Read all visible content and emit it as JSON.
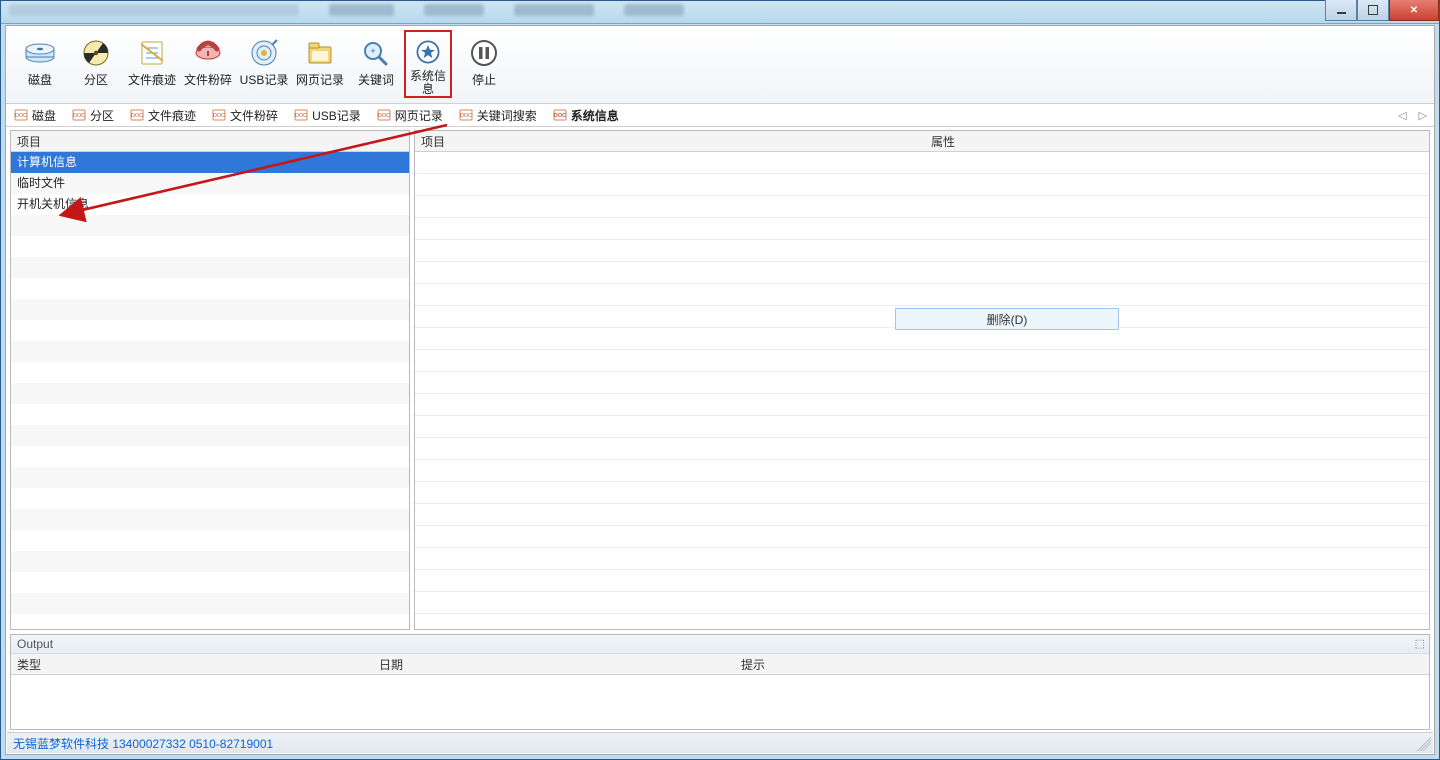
{
  "toolbar": [
    {
      "id": "disk",
      "label": "磁盘"
    },
    {
      "id": "partition",
      "label": "分区"
    },
    {
      "id": "file-trace",
      "label": "文件痕迹"
    },
    {
      "id": "file-shred",
      "label": "文件粉碎"
    },
    {
      "id": "usb-record",
      "label": "USB记录"
    },
    {
      "id": "web-record",
      "label": "网页记录"
    },
    {
      "id": "keyword",
      "label": "关键词"
    },
    {
      "id": "system-info",
      "label": "系统信息"
    },
    {
      "id": "stop",
      "label": "停止"
    }
  ],
  "toolbar_selected": "system-info",
  "tabs": [
    {
      "id": "tab-disk",
      "label": "磁盘"
    },
    {
      "id": "tab-partition",
      "label": "分区"
    },
    {
      "id": "tab-file-trace",
      "label": "文件痕迹"
    },
    {
      "id": "tab-file-shred",
      "label": "文件粉碎"
    },
    {
      "id": "tab-usb-record",
      "label": "USB记录"
    },
    {
      "id": "tab-web-record",
      "label": "网页记录"
    },
    {
      "id": "tab-keyword-search",
      "label": "关键词搜索"
    },
    {
      "id": "tab-system-info",
      "label": "系统信息"
    }
  ],
  "tabs_active": "tab-system-info",
  "left_panel": {
    "header": "项目",
    "items": [
      "计算机信息",
      "临时文件",
      "开机关机信息"
    ],
    "selected_index": 0
  },
  "right_panel": {
    "headers": {
      "item": "项目",
      "attr": "属性"
    },
    "context_button": "删除(D)"
  },
  "output": {
    "title": "Output",
    "headers": {
      "type": "类型",
      "date": "日期",
      "tip": "提示"
    }
  },
  "statusbar": {
    "text": "无锡蓝梦软件科技 13400027332  0510-82719001"
  }
}
